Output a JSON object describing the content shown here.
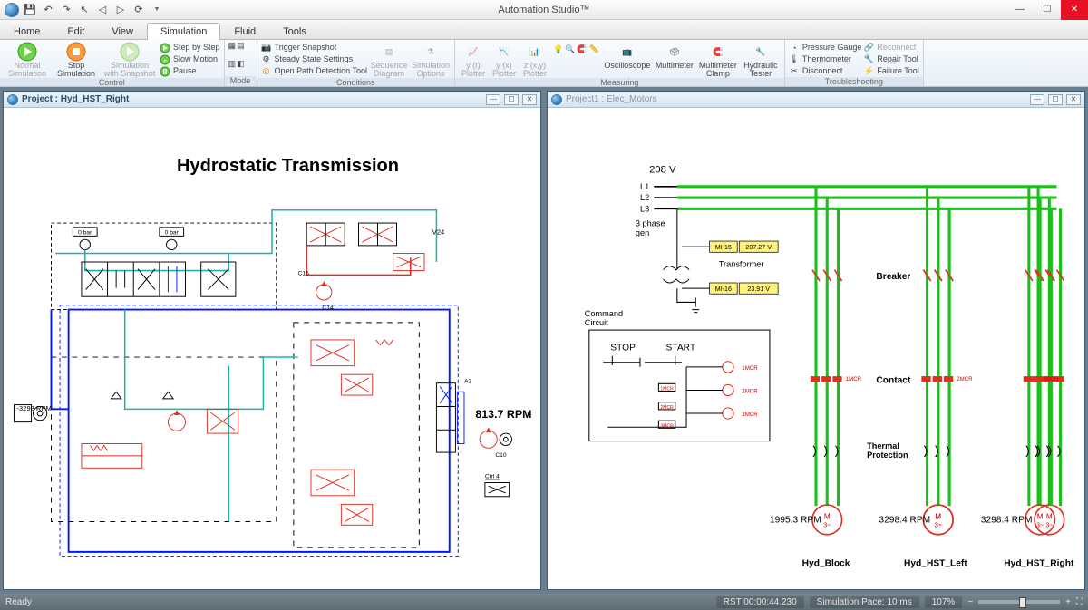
{
  "app": {
    "title": "Automation Studio™"
  },
  "qat": {
    "items": [
      "logo",
      "save",
      "undo",
      "redo",
      "print",
      "arrow",
      "refresh",
      "dropdown"
    ]
  },
  "tabs": [
    "Home",
    "Edit",
    "View",
    "Simulation",
    "Fluid",
    "Tools"
  ],
  "active_tab": 3,
  "ribbon": {
    "control": {
      "label": "Control",
      "normal": "Normal\nSimulation",
      "stop": "Stop\nSimulation",
      "snapshot": "Simulation\nwith Snapshot",
      "step": "Step by Step",
      "slow": "Slow Motion",
      "pause": "Pause"
    },
    "mode": {
      "label": "Mode"
    },
    "conditions": {
      "label": "Conditions",
      "trigger": "Trigger Snapshot",
      "steady": "Steady State Settings",
      "openpath": "Open Path Detection Tool",
      "seq": "Sequence\nDiagram",
      "opts": "Simulation\nOptions"
    },
    "measuring": {
      "label": "Measuring",
      "y1": "y (t)\nPlotter",
      "y2": "y (x)\nPlotter",
      "z": "z (x,y)\nPlotter",
      "osc": "Oscilloscope",
      "mm": "Multimeter",
      "mmc": "Multimeter\nClamp",
      "ht": "Hydraulic\nTester"
    },
    "trouble": {
      "label": "Troubleshooting",
      "pg": "Pressure Gauge",
      "th": "Thermometer",
      "dc": "Disconnect",
      "rc": "Reconnect",
      "rt": "Repair Tool",
      "ft": "Failure Tool"
    }
  },
  "docs": {
    "left": {
      "title": "Project : Hyd_HST_Right",
      "heading": "Hydrostatic Transmission",
      "bar0a": "0 bar",
      "bar0b": "0 bar",
      "v24": "V24",
      "c15": "C15",
      "c14": "C14",
      "rpm_in": "-3298 RPM",
      "rpm_out": "813.7 RPM",
      "a3": "A3",
      "c10": "C10",
      "ctrl4": "Ctrl 4"
    },
    "right": {
      "title": "Project1 : Elec_Motors",
      "v208": "208 V",
      "l1": "L1",
      "l2": "L2",
      "l3": "L3",
      "phase": "3 phase\ngen",
      "mi15": "MI-15",
      "mi15v": "207.27 V",
      "trans": "Transformer",
      "mi16": "MI-16",
      "mi16v": "23.91 V",
      "breaker": "Breaker",
      "contact": "Contact",
      "thermal": "Thermal\nProtection",
      "cmd": "Command\nCircuit",
      "stop": "STOP",
      "start": "START",
      "r1": "1MCR",
      "r2": "2MCR",
      "r3": "3MCR",
      "rpm1": "1995.3 RPM",
      "rpm2": "3298.4 RPM",
      "rpm3": "3298.4 RPM",
      "m1": "Hyd_Block",
      "m2": "Hyd_HST_Left",
      "m3": "Hyd_HST_Right"
    }
  },
  "status": {
    "ready": "Ready",
    "rst": "RST 00:00:44.230",
    "pace": "Simulation Pace: 10 ms",
    "zoom": "107%"
  }
}
